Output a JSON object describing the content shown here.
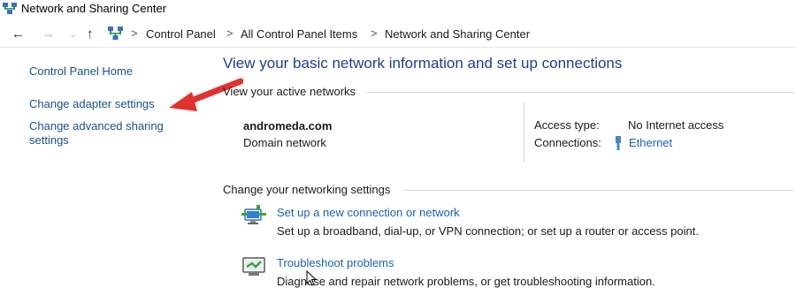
{
  "window": {
    "title": "Network and Sharing Center"
  },
  "address_bar": {
    "back": "←",
    "forward": "→",
    "up": "↑",
    "separator": ">",
    "crumbs": [
      "Control Panel",
      "All Control Panel Items",
      "Network and Sharing Center"
    ]
  },
  "sidebar": {
    "home": "Control Panel Home",
    "adapter": "Change adapter settings",
    "advanced_line1": "Change advanced sharing",
    "advanced_line2": "settings"
  },
  "main": {
    "title": "View your basic network information and set up connections",
    "active_header": "View your active networks",
    "network_name": "andromeda.com",
    "network_category": "Domain network",
    "access_label": "Access type:",
    "access_value": "No Internet access",
    "connections_label": "Connections:",
    "connections_value": "Ethernet",
    "change_header": "Change your networking settings",
    "tasks": [
      {
        "icon": "network-setup-icon",
        "link": "Set up a new connection or network",
        "desc": "Set up a broadband, dial-up, or VPN connection; or set up a router or access point."
      },
      {
        "icon": "troubleshoot-icon",
        "link": "Troubleshoot problems",
        "desc": "Diagnose and repair network problems, or get troubleshooting information."
      }
    ]
  },
  "colors": {
    "link": "#1a5fb4",
    "title": "#1e3d8f",
    "arrow": "#e0332e",
    "sidebar_link": "#1a4f8b"
  }
}
